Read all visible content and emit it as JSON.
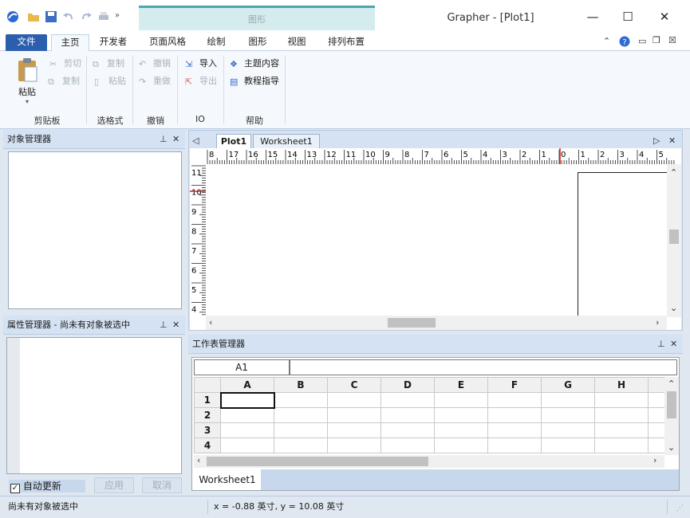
{
  "window": {
    "title": "Grapher - [Plot1]",
    "context_tab": "图形",
    "minimize": "—",
    "maximize": "☐",
    "close": "✕"
  },
  "tabs": [
    {
      "label": "文件"
    },
    {
      "label": "主页"
    },
    {
      "label": "开发者"
    },
    {
      "label": "页面风格"
    },
    {
      "label": "绘制"
    },
    {
      "label": "图形"
    },
    {
      "label": "视图"
    },
    {
      "label": "排列布置"
    }
  ],
  "ribbon": {
    "clipboard": {
      "paste": "粘贴",
      "cut": "剪切",
      "copy": "复制",
      "group": "剪贴板"
    },
    "format": {
      "copy": "复制",
      "paste": "粘贴",
      "group": "选格式"
    },
    "undo": {
      "undo": "撤销",
      "redo": "重做",
      "group": "撤销"
    },
    "io": {
      "import": "导入",
      "export": "导出",
      "group": "IO"
    },
    "help": {
      "topics": "主题内容",
      "tutorial": "教程指导",
      "group": "帮助"
    }
  },
  "object_manager": {
    "title": "对象管理器"
  },
  "property_manager": {
    "title": "属性管理器 - 尚未有对象被选中",
    "auto_update": "自动更新",
    "apply": "应用",
    "cancel": "取消"
  },
  "documents": {
    "tabs": [
      "Plot1",
      "Worksheet1"
    ],
    "active": "Plot1"
  },
  "ruler": {
    "h_labels": [
      "8",
      "17",
      "16",
      "15",
      "14",
      "13",
      "12",
      "11",
      "10",
      "9",
      "8",
      "7",
      "6",
      "5",
      "4",
      "3",
      "2",
      "1",
      "0",
      "1",
      "2",
      "3",
      "4",
      "5"
    ],
    "v_labels": [
      "11",
      "10",
      "9",
      "8",
      "7",
      "6",
      "5",
      "4"
    ]
  },
  "worksheet_manager": {
    "title": "工作表管理器",
    "cell_ref": "A1",
    "formula": "",
    "columns": [
      "A",
      "B",
      "C",
      "D",
      "E",
      "F",
      "G",
      "H"
    ],
    "rows": [
      "1",
      "2",
      "3",
      "4"
    ],
    "sheet_tab": "Worksheet1"
  },
  "status": {
    "left": "尚未有对象被选中",
    "coords": "x = -0.88 英寸, y = 10.08 英寸"
  },
  "colors": {
    "file_tab": "#2b5fae",
    "context": "#48a6b0",
    "panel_head": "#d4e2f3"
  }
}
